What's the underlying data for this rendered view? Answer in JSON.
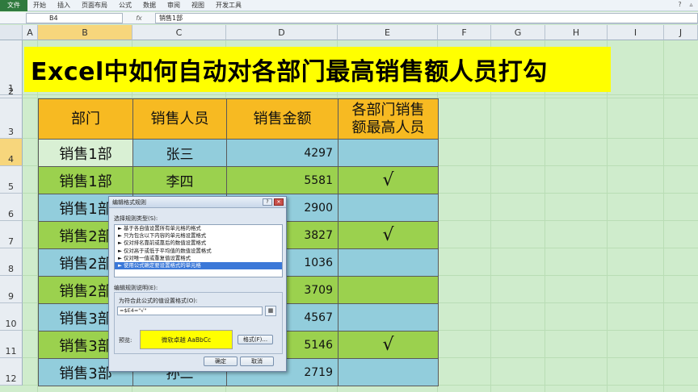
{
  "ribbon": {
    "file_tab": "文件",
    "tabs": [
      "开始",
      "插入",
      "页面布局",
      "公式",
      "数据",
      "审阅",
      "视图",
      "开发工具"
    ]
  },
  "formula_bar": {
    "name_box": "B4",
    "fx": "fx",
    "value": "销售1部"
  },
  "columns": [
    "A",
    "B",
    "C",
    "D",
    "E",
    "F",
    "G",
    "H",
    "I",
    "J"
  ],
  "rows": [
    "1",
    "2",
    "3",
    "4",
    "5",
    "6",
    "7",
    "8",
    "9",
    "10",
    "11",
    "12"
  ],
  "title": "Excel中如何自动对各部门最高销售额人员打勾",
  "table": {
    "headers": [
      "部门",
      "销售人员",
      "销售金额",
      "各部门销售\n额最高人员"
    ],
    "rows": [
      {
        "dept": "销售1部",
        "name": "张三",
        "amount": "4297",
        "mark": ""
      },
      {
        "dept": "销售1部",
        "name": "李四",
        "amount": "5581",
        "mark": "√"
      },
      {
        "dept": "销售1部",
        "name": "",
        "amount": "2900",
        "mark": ""
      },
      {
        "dept": "销售2部",
        "name": "",
        "amount": "3827",
        "mark": "√"
      },
      {
        "dept": "销售2部",
        "name": "",
        "amount": "1036",
        "mark": ""
      },
      {
        "dept": "销售2部",
        "name": "",
        "amount": "3709",
        "mark": ""
      },
      {
        "dept": "销售3部",
        "name": "",
        "amount": "4567",
        "mark": ""
      },
      {
        "dept": "销售3部",
        "name": "",
        "amount": "5146",
        "mark": "√"
      },
      {
        "dept": "销售3部",
        "name": "孙二",
        "amount": "2719",
        "mark": ""
      }
    ]
  },
  "dialog": {
    "title": "编辑格式规则",
    "select_rule_type_label": "选择规则类型(S):",
    "rule_types": [
      "► 基于各自值设置所有单元格的格式",
      "► 只为包含以下内容的单元格设置格式",
      "► 仅对排名靠前或靠后的数值设置格式",
      "► 仅对高于或低于平均值的数值设置格式",
      "► 仅对唯一值或重复值设置格式",
      "► 使用公式确定要设置格式的单元格"
    ],
    "selected_rule_index": 5,
    "edit_rule_label": "编辑规则说明(E):",
    "formula_label": "为符合此公式的值设置格式(O):",
    "formula_value": "=$E4=\"√\"",
    "preview_label": "预览:",
    "preview_text": "微软卓越  AaBbCc",
    "format_button": "格式(F)...",
    "ok_button": "确定",
    "cancel_button": "取消"
  }
}
